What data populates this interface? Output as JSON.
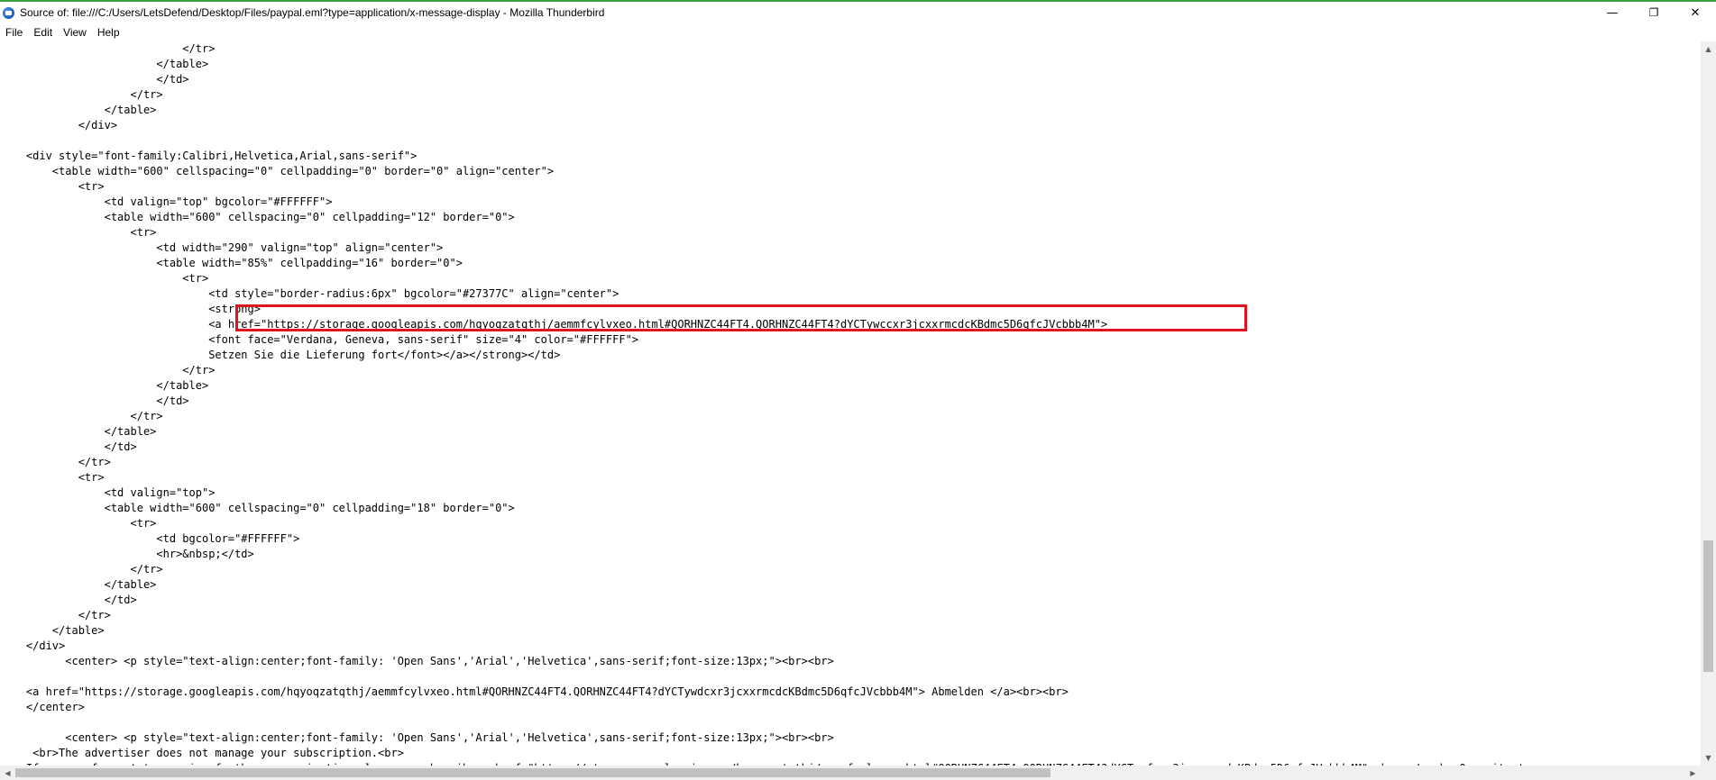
{
  "window": {
    "title": "Source of: file:///C:/Users/LetsDefend/Desktop/Files/paypal.eml?type=application/x-message-display - Mozilla Thunderbird",
    "minimize_glyph": "—",
    "restore_glyph": "❐",
    "close_glyph": "✕",
    "accent_color": "#3a9e3a"
  },
  "menu": {
    "items": [
      {
        "label": "File"
      },
      {
        "label": "Edit"
      },
      {
        "label": "View"
      },
      {
        "label": "Help"
      }
    ]
  },
  "source": {
    "highlight_color": "#e0141e",
    "lines": [
      "                            </tr>",
      "                        </table>",
      "                        </td>",
      "                    </tr>",
      "                </table>",
      "            </div>",
      "",
      "    <div style=\"font-family:Calibri,Helvetica,Arial,sans-serif\">",
      "        <table width=\"600\" cellspacing=\"0\" cellpadding=\"0\" border=\"0\" align=\"center\">",
      "            <tr>",
      "                <td valign=\"top\" bgcolor=\"#FFFFFF\">",
      "                <table width=\"600\" cellspacing=\"0\" cellpadding=\"12\" border=\"0\">",
      "                    <tr>",
      "                        <td width=\"290\" valign=\"top\" align=\"center\">",
      "                        <table width=\"85%\" cellpadding=\"16\" border=\"0\">",
      "                            <tr>",
      "                                <td style=\"border-radius:6px\" bgcolor=\"#27377C\" align=\"center\">",
      "                                <strong>",
      "                                <a href=\"https://storage.googleapis.com/hqyoqzatqthj/aemmfcylvxeo.html#QORHNZC44FT4.QORHNZC44FT4?dYCTywccxr3jcxxrmcdcKBdmc5D6qfcJVcbbb4M\">",
      "                                <font face=\"Verdana, Geneva, sans-serif\" size=\"4\" color=\"#FFFFFF\">",
      "                                Setzen Sie die Lieferung fort</font></a></strong></td>",
      "                            </tr>",
      "                        </table>",
      "                        </td>",
      "                    </tr>",
      "                </table>",
      "                </td>",
      "            </tr>",
      "            <tr>",
      "                <td valign=\"top\">",
      "                <table width=\"600\" cellspacing=\"0\" cellpadding=\"18\" border=\"0\">",
      "                    <tr>",
      "                        <td bgcolor=\"#FFFFFF\">",
      "                        <hr>&nbsp;</td>",
      "                    </tr>",
      "                </table>",
      "                </td>",
      "            </tr>",
      "        </table>",
      "    </div>",
      "          <center> <p style=\"text-align:center;font-family: 'Open Sans','Arial','Helvetica',sans-serif;font-size:13px;\"><br><br>",
      "",
      "    <a href=\"https://storage.googleapis.com/hqyoqzatqthj/aemmfcylvxeo.html#QORHNZC44FT4.QORHNZC44FT4?dYCTywdcxr3jcxxrmcdcKBdmc5D6qfcJVcbbb4M\"> Abmelden </a><br><br>",
      "    </center>",
      "",
      "          <center> <p style=\"text-align:center;font-family: 'Open Sans','Arial','Helvetica',sans-serif;font-size:13px;\"><br><br>",
      "     <br>The advertiser does not manage your subscription.<br>",
      "    If you prefer not to receive further communication please unsubscribe<a href=\"https://storage.googleapis.com/hqyoqzatqthj/aemmfcylvxeo.html#QORHNZC44FT4.QORHNZC44FT4?dYCTywfcxr3jcxxrmcdcKBdmc5D6qfcJVcbbb4M\"> here</a><br>Or write t"
    ]
  },
  "scrollbars": {
    "vertical_position": 0.86,
    "vertical_visible_fraction": 0.19,
    "horizontal_position": 0.0,
    "horizontal_visible_fraction": 0.62
  }
}
